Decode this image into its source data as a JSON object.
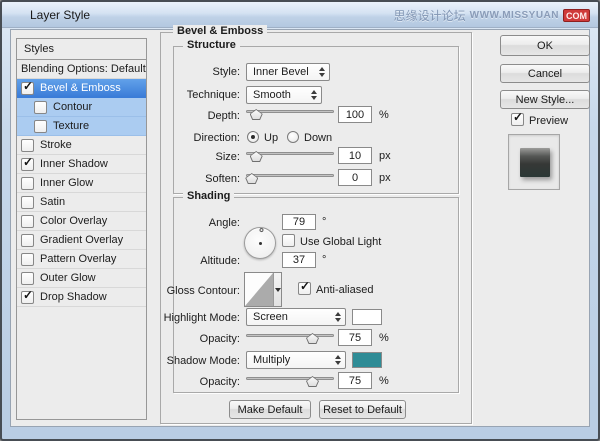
{
  "window": {
    "title": "Layer Style"
  },
  "watermark": {
    "text": "思缘设计论坛",
    "url": "WWW.MISSYUAN",
    "badge": "COM"
  },
  "icons": {
    "check": "✓"
  },
  "colors": {
    "selected_row": "#4a8de4",
    "highlight_row": "#abccf1",
    "highlight_swatch": "#ffffff",
    "shadow_swatch": "#2e8c96"
  },
  "styles_panel": {
    "header": "Styles",
    "items": [
      {
        "label": "Blending Options: Default",
        "checkbox": false,
        "checked": false,
        "state": "",
        "indent": false
      },
      {
        "label": "Bevel & Emboss",
        "checkbox": true,
        "checked": true,
        "state": "selected",
        "indent": false
      },
      {
        "label": "Contour",
        "checkbox": true,
        "checked": false,
        "state": "highlight",
        "indent": true
      },
      {
        "label": "Texture",
        "checkbox": true,
        "checked": false,
        "state": "highlight",
        "indent": true
      },
      {
        "label": "Stroke",
        "checkbox": true,
        "checked": false,
        "state": "",
        "indent": false
      },
      {
        "label": "Inner Shadow",
        "checkbox": true,
        "checked": true,
        "state": "",
        "indent": false
      },
      {
        "label": "Inner Glow",
        "checkbox": true,
        "checked": false,
        "state": "",
        "indent": false
      },
      {
        "label": "Satin",
        "checkbox": true,
        "checked": false,
        "state": "",
        "indent": false
      },
      {
        "label": "Color Overlay",
        "checkbox": true,
        "checked": false,
        "state": "",
        "indent": false
      },
      {
        "label": "Gradient Overlay",
        "checkbox": true,
        "checked": false,
        "state": "",
        "indent": false
      },
      {
        "label": "Pattern Overlay",
        "checkbox": true,
        "checked": false,
        "state": "",
        "indent": false
      },
      {
        "label": "Outer Glow",
        "checkbox": true,
        "checked": false,
        "state": "",
        "indent": false
      },
      {
        "label": "Drop Shadow",
        "checkbox": true,
        "checked": true,
        "state": "",
        "indent": false
      }
    ]
  },
  "panel": {
    "title": "Bevel & Emboss",
    "structure": {
      "title": "Structure",
      "style_label": "Style:",
      "style_value": "Inner Bevel",
      "technique_label": "Technique:",
      "technique_value": "Smooth",
      "depth_label": "Depth:",
      "depth_value": "100",
      "depth_unit": "%",
      "depth_slider_pct": 11,
      "direction_label": "Direction:",
      "direction_up": "Up",
      "direction_down": "Down",
      "direction_selected": "Up",
      "size_label": "Size:",
      "size_value": "10",
      "size_unit": "px",
      "size_slider_pct": 11,
      "soften_label": "Soften:",
      "soften_value": "0",
      "soften_unit": "px",
      "soften_slider_pct": 6
    },
    "shading": {
      "title": "Shading",
      "angle_label": "Angle:",
      "angle_value": "79",
      "angle_unit": "°",
      "use_global_light_label": "Use Global Light",
      "use_global_light_checked": false,
      "altitude_label": "Altitude:",
      "altitude_value": "37",
      "altitude_unit": "°",
      "gloss_label": "Gloss Contour:",
      "anti_aliased_label": "Anti-aliased",
      "anti_aliased_checked": true,
      "highlight_label": "Highlight Mode:",
      "highlight_value": "Screen",
      "highlight_opacity_label": "Opacity:",
      "highlight_opacity_value": "75",
      "highlight_opacity_unit": "%",
      "highlight_opacity_pct": 75,
      "shadow_label": "Shadow Mode:",
      "shadow_value": "Multiply",
      "shadow_opacity_label": "Opacity:",
      "shadow_opacity_value": "75",
      "shadow_opacity_unit": "%",
      "shadow_opacity_pct": 75
    },
    "footer": {
      "make_default": "Make Default",
      "reset_default": "Reset to Default"
    }
  },
  "actions": {
    "ok": "OK",
    "cancel": "Cancel",
    "new_style": "New Style...",
    "preview": "Preview",
    "preview_checked": true
  }
}
